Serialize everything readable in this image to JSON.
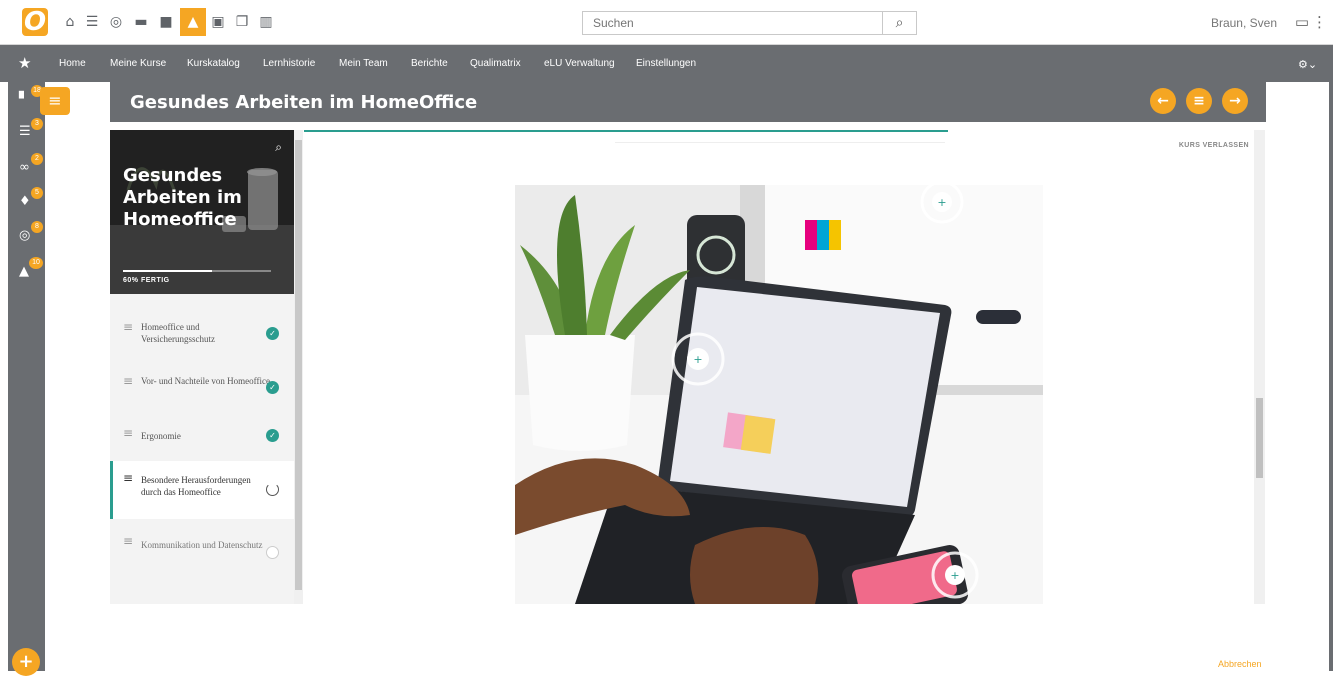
{
  "topbar": {
    "logo": "O",
    "search_placeholder": "Suchen",
    "user_name": "Braun, Sven"
  },
  "nav": {
    "items": [
      "Home",
      "Meine Kurse",
      "Kurskatalog",
      "Lernhistorie",
      "Mein Team",
      "Berichte",
      "Qualimatrix",
      "eLU Verwaltung",
      "Einstellungen"
    ]
  },
  "rail": {
    "badges": [
      "18",
      "3",
      "2",
      "5",
      "8",
      "10"
    ]
  },
  "course": {
    "title": "Gesundes Arbeiten im HomeOffice",
    "hero_title": "Gesundes Arbeiten im Homeoffice",
    "progress_label": "60% FERTIG",
    "progress": 0.6,
    "leave_label": "KURS VERLASSEN",
    "cancel_label": "Abbrechen"
  },
  "lessons": [
    {
      "title": "Homeoffice und Versicherungsschutz",
      "status": "done"
    },
    {
      "title": "Vor- und Nachteile von Homeoffice",
      "status": "done"
    },
    {
      "title": "Ergonomie",
      "status": "done"
    },
    {
      "title": "Besondere Herausforderungen durch das Homeoffice",
      "status": "in-progress"
    },
    {
      "title": "Kommunikation und Datenschutz",
      "status": "open"
    }
  ],
  "colors": {
    "accent": "#f5a623",
    "teal": "#2a9d8f",
    "bar": "#6a6d71"
  }
}
